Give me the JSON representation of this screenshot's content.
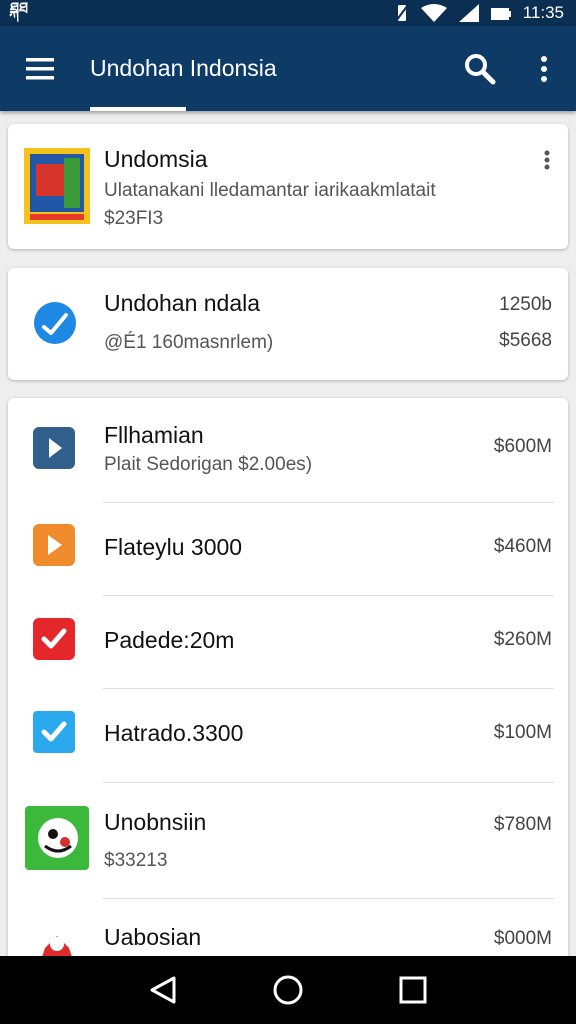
{
  "status_bar": {
    "left_text": "ཐྐཐ",
    "time": "11:35"
  },
  "app_bar": {
    "title": "Undohan Indonsia",
    "menu_icon": "hamburger-icon",
    "search_icon": "search-icon",
    "more_icon": "more-vert-icon"
  },
  "card1": {
    "title": "Undomsia",
    "subtitle": "Ulatanakani lledamantar iarikaakmlatait",
    "price": "$23FI3"
  },
  "card2": {
    "title": "Undohan ndala",
    "subtitle": "@É1 160masnrlem)",
    "right_top": "1250b",
    "right_bottom": "$5668",
    "icon": "check-circle-icon"
  },
  "list": [
    {
      "title": "Fllhamian",
      "subtitle": "Plait Sedorigan $2.00es)",
      "price": "$600M",
      "icon": "play-icon",
      "color": "#2f5f8a"
    },
    {
      "title": "Flateylu 3000",
      "subtitle": "",
      "price": "$460M",
      "icon": "play-icon",
      "color": "#ef8b2a"
    },
    {
      "title": "Padede:20m",
      "subtitle": "",
      "price": "$260M",
      "icon": "check-icon",
      "color": "#e5262b"
    },
    {
      "title": "Hatrado.3300",
      "subtitle": "",
      "price": "$100M",
      "icon": "check-icon",
      "color": "#2aa9ee"
    },
    {
      "title": "Unobnsiin",
      "subtitle": "$33213",
      "price": "$780M",
      "icon": "game-icon",
      "color": "#3cb83a"
    },
    {
      "title": "Uabosian",
      "subtitle": "",
      "price": "$000M",
      "icon": "game-icon",
      "color": "#e02b2b"
    }
  ],
  "nav": {
    "back_icon": "back-icon",
    "home_icon": "home-icon",
    "recents_icon": "recents-icon"
  }
}
